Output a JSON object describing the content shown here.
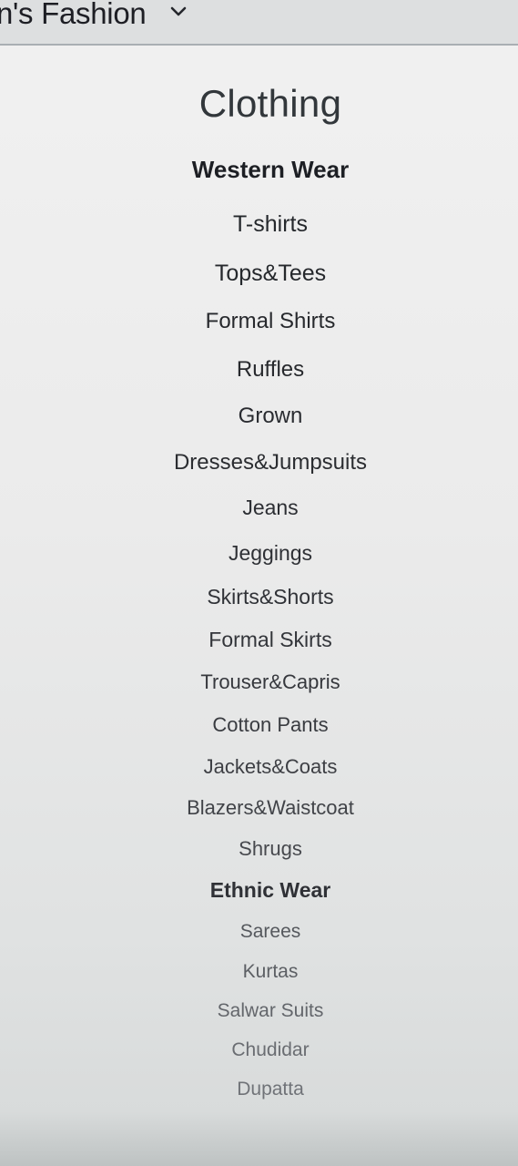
{
  "header": {
    "title": "n's Fashion",
    "dropdown_icon": "chevron-down-icon"
  },
  "menu": {
    "heading": "Clothing",
    "western": {
      "label": "Western Wear",
      "items": [
        "T-shirts",
        "Tops&Tees",
        "Formal Shirts",
        "Ruffles",
        "Grown",
        "Dresses&Jumpsuits",
        "Jeans",
        "Jeggings",
        "Skirts&Shorts",
        "Formal Skirts",
        "Trouser&Capris",
        "Cotton Pants",
        "Jackets&Coats",
        "Blazers&Waistcoat",
        "Shrugs"
      ]
    },
    "ethnic": {
      "label": "Ethnic Wear",
      "items": [
        "Sarees",
        "Kurtas",
        "Salwar Suits",
        "Chudidar",
        "Dupatta"
      ]
    }
  }
}
